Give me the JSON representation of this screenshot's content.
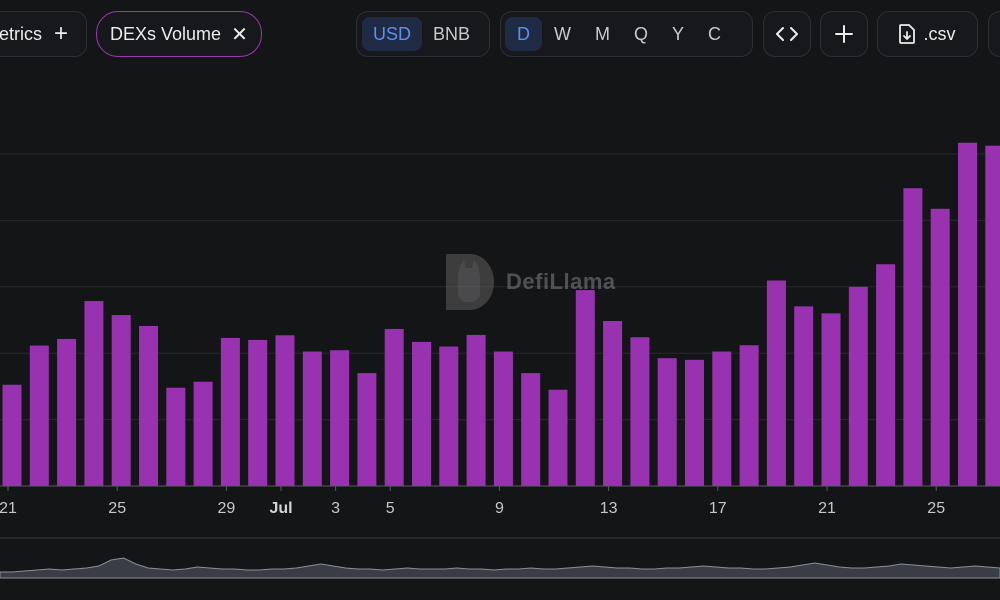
{
  "toolbar": {
    "metrics_label": "etrics",
    "dex_chip_label": "DEXs Volume",
    "currency_options": [
      "USD",
      "BNB"
    ],
    "currency_selected": "USD",
    "interval_options": [
      "D",
      "W",
      "M",
      "Q",
      "Y",
      "C"
    ],
    "interval_selected": "D",
    "csv_label": ".csv"
  },
  "watermark": {
    "text": "DefiLlama"
  },
  "colors": {
    "bar": "#9932b0",
    "active_bg": "#1f2b45",
    "active_text": "#5c8ff0",
    "chip_border": "#9a3ab1"
  },
  "chart_data": {
    "type": "bar",
    "title": "",
    "xlabel": "",
    "ylabel": "",
    "unit": "USD",
    "x_tick_labels": [
      "21",
      "25",
      "29",
      "Jul",
      "3",
      "5",
      "9",
      "13",
      "17",
      "21",
      "25"
    ],
    "ylim": [
      0,
      100
    ],
    "grid": true,
    "values": [
      30.5,
      42.3,
      44.3,
      55.7,
      51.5,
      48.2,
      29.6,
      31.4,
      44.6,
      44.0,
      45.4,
      40.5,
      40.9,
      34.0,
      47.3,
      43.4,
      42.0,
      45.5,
      40.5,
      34.0,
      29.0,
      59.0,
      49.7,
      44.8,
      38.5,
      38.0,
      40.5,
      42.4,
      61.9,
      54.1,
      52.0,
      60.0,
      66.8,
      89.7,
      83.5,
      103.4,
      102.5
    ],
    "overview": {
      "description_free": true,
      "values": [
        6,
        6,
        7,
        8,
        9,
        8,
        9,
        10,
        12,
        18,
        20,
        14,
        10,
        9,
        8,
        9,
        11,
        10,
        9,
        9,
        8,
        8,
        9,
        9,
        10,
        12,
        14,
        12,
        10,
        9,
        9,
        8,
        9,
        10,
        9,
        9,
        9,
        10,
        9,
        9,
        8,
        9,
        9,
        10,
        9,
        9,
        10,
        11,
        12,
        11,
        10,
        10,
        9,
        9,
        10,
        10,
        11,
        12,
        11,
        10,
        10,
        9,
        9,
        10,
        11,
        13,
        15,
        13,
        11,
        10,
        10,
        11,
        12,
        14,
        13,
        12,
        11,
        10,
        11,
        12,
        11,
        10
      ]
    }
  }
}
